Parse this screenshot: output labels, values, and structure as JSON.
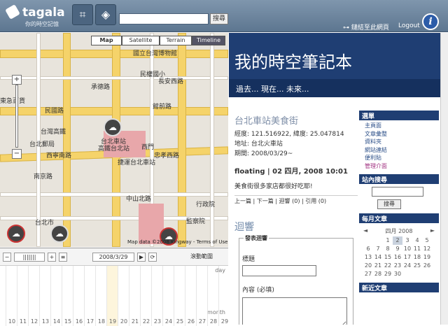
{
  "header": {
    "logo_name": "tagala",
    "logo_sub": "你的時空記憶",
    "search_button": "搜尋",
    "link_page": "鏈結至此網頁",
    "logout": "Logout",
    "info": "i"
  },
  "map": {
    "types": [
      "Map",
      "Satellite",
      "Terrain",
      "Timeline"
    ],
    "labels": [
      "國立台灣博物館",
      "民權國小",
      "民國路",
      "館前路",
      "長安西路",
      "承德路",
      "台灣高鐵",
      "台北郵局",
      "西門",
      "西寧南路",
      "台北車站",
      "高鐵台北站",
      "忠孝西路",
      "捷運台北車站",
      "南京路",
      "中山北路",
      "行政院",
      "監察院",
      "東急百貨",
      "台北市"
    ],
    "copyright": "Map data ©2008 Kingway - Terms of Use"
  },
  "timeline": {
    "date": "2008/3/29",
    "range_label": "滾動範圍",
    "day": "day",
    "month": "month",
    "numbers": [
      "10",
      "11",
      "12",
      "13",
      "14",
      "15",
      "16",
      "17",
      "18",
      "19",
      "20",
      "21",
      "22",
      "23",
      "24",
      "25",
      "26",
      "27",
      "28",
      "29"
    ]
  },
  "blog": {
    "title": "我的時空筆記本",
    "subtitle": "過去... 現在... 未來...",
    "post_title": "台北車站美食街",
    "lng_lat": "經度: 121.516922, 緯度: 25.047814",
    "address": "地址: 台北火車站",
    "period": "期間: 2008/03/29~",
    "meta": "floating | 02 四月, 2008 10:01",
    "text": "美食街很多家店都很好吃耶!",
    "links": "上一篇 | 下一篇 | 迴響 (0) | 引用 (0)",
    "reply_title": "迴響",
    "form_legend": "發表迴響",
    "form_title": "標題",
    "form_content": "內容 (必填)"
  },
  "sidebar": {
    "options_title": "選單",
    "options": [
      "主頁面",
      "文章彙整",
      "資料夾",
      "網站連結",
      "便利貼",
      "管理介面"
    ],
    "search_title": "站內搜尋",
    "search_button": "搜尋",
    "archive_title": "每月文章",
    "cal_month": "四月 2008",
    "cal_rows": [
      [
        "",
        "",
        "1",
        "2",
        "3",
        "4",
        "5"
      ],
      [
        "6",
        "7",
        "8",
        "9",
        "10",
        "11",
        "12"
      ],
      [
        "13",
        "14",
        "15",
        "16",
        "17",
        "18",
        "19"
      ],
      [
        "20",
        "21",
        "22",
        "23",
        "24",
        "25",
        "26"
      ],
      [
        "27",
        "28",
        "29",
        "30",
        "",
        "",
        ""
      ]
    ],
    "latest_title": "新近文章"
  }
}
